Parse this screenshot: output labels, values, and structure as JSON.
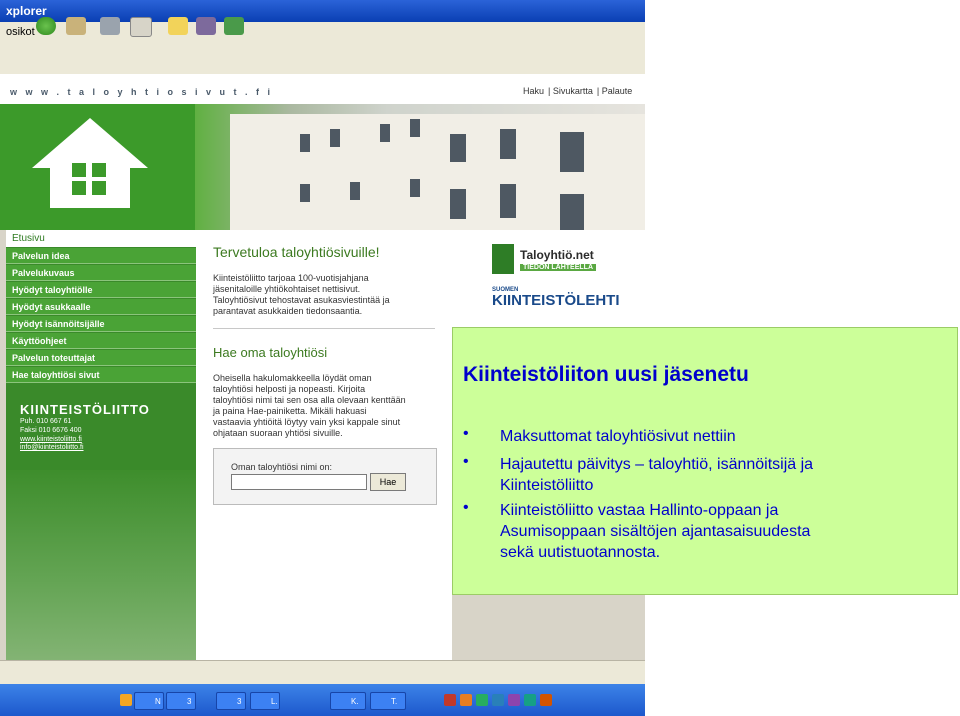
{
  "browser": {
    "title": "xplorer",
    "toolbar_label": "osikot",
    "url": "w w w . t a l o y h t i o s i v u t . f i",
    "site_links": [
      "Haku",
      "Sivukartta",
      "Palaute"
    ]
  },
  "sidebar": {
    "home": "Etusivu",
    "items": [
      {
        "label": "Palvelun idea"
      },
      {
        "label": "Palvelukuvaus"
      },
      {
        "label": "Hyödyt taloyhtiölle"
      },
      {
        "label": "Hyödyt asukkaalle"
      },
      {
        "label": "Hyödyt isännöitsijälle"
      },
      {
        "label": "Käyttöohjeet"
      },
      {
        "label": "Palvelun toteuttajat"
      },
      {
        "label": "Hae taloyhtiösi sivut"
      }
    ],
    "org_name": "KIINTEISTÖLIITTO",
    "phone": "Puh. 010 667 61",
    "fax": "Faksi 010 6676 400",
    "web": "www.kiinteistoliitto.fi",
    "email": "info@kiinteistoliitto.fi"
  },
  "main": {
    "welcome_title": "Tervetuloa taloyhtiösivuille!",
    "welcome_text": [
      "Kiinteistöliitto tarjoaa 100-vuotisjahjana",
      "jäsenitaloille yhtiökohtaiset nettisivut.",
      "Taloyhtiösivut tehostavat asukasviestintää ja",
      "parantavat asukkaiden tiedonsaantia."
    ],
    "search_title": "Hae oma taloyhtiösi",
    "search_text": [
      "Oheisella hakulomakkeella löydät oman",
      "taloyhtiösi helposti ja nopeasti. Kirjoita",
      "taloyhtiösi nimi tai sen osa alla olevaan kenttään",
      "ja paina Hae-painiketta. Mikäli hakuasi",
      "vastaavia yhtiöitä löytyy vain yksi kappale sinut",
      "ohjataan suoraan yhtiösi sivuille."
    ],
    "search_label": "Oman taloyhtiösi nimi on:",
    "search_button": "Hae"
  },
  "right_logos": {
    "taloyhtio": "Taloyhtiö.net",
    "taloyhtio_tag": "TIEDON LÄHTEELLÄ",
    "suomen": "SUOMEN",
    "kiinteistolehti": "KIINTEISTÖLEHTI"
  },
  "taskbar": {
    "items": [
      "N",
      "3",
      "3",
      "L.",
      "K.",
      "T."
    ]
  },
  "callout": {
    "title": "Kiinteistöliiton uusi jäsenetu",
    "bullets": [
      {
        "lines": [
          "Maksuttomat taloyhtiösivut nettiin"
        ]
      },
      {
        "lines": [
          "Hajautettu päivitys – taloyhtiö, isännöitsijä ja",
          "Kiinteistöliitto"
        ]
      },
      {
        "lines": [
          "Kiinteistöliitto vastaa Hallinto-oppaan ja",
          "Asumisoppaan sisältöjen ajantasaisuudesta",
          "sekä uutistuotannosta."
        ]
      }
    ],
    "bullet_char": "•",
    "colors": {
      "background": "#ccff99",
      "text": "#0000cc"
    }
  }
}
